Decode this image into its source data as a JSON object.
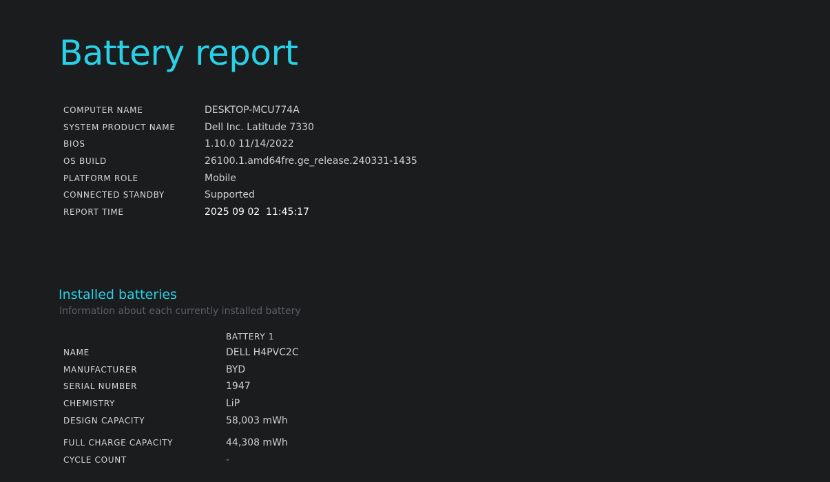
{
  "title": "Battery report",
  "system_info": [
    {
      "label": "COMPUTER NAME",
      "value": "DESKTOP-MCU774A"
    },
    {
      "label": "SYSTEM PRODUCT NAME",
      "value": "Dell Inc. Latitude 7330"
    },
    {
      "label": "BIOS",
      "value": "1.10.0 11/14/2022"
    },
    {
      "label": "OS BUILD",
      "value": "26100.1.amd64fre.ge_release.240331-1435"
    },
    {
      "label": "PLATFORM ROLE",
      "value": "Mobile"
    },
    {
      "label": "CONNECTED STANDBY",
      "value": "Supported"
    },
    {
      "label": "REPORT TIME",
      "value": "2025 09 02  11:45:17"
    }
  ],
  "installed_batteries": {
    "title": "Installed batteries",
    "subtitle": "Information about each currently installed battery",
    "column_header": "BATTERY 1",
    "rows": [
      {
        "label": "NAME",
        "value": "DELL H4PVC2C"
      },
      {
        "label": "MANUFACTURER",
        "value": "BYD"
      },
      {
        "label": "SERIAL NUMBER",
        "value": "1947"
      },
      {
        "label": "CHEMISTRY",
        "value": "LiP"
      },
      {
        "label": "DESIGN CAPACITY",
        "value": "58,003 mWh"
      },
      {
        "label": "FULL CHARGE CAPACITY",
        "value": "44,308 mWh"
      },
      {
        "label": "CYCLE COUNT",
        "value": "-"
      }
    ]
  },
  "colors": {
    "background": "#1a1c1e",
    "accent": "#29d1e6",
    "text": "#d6d6d6",
    "muted": "#5c6064"
  }
}
